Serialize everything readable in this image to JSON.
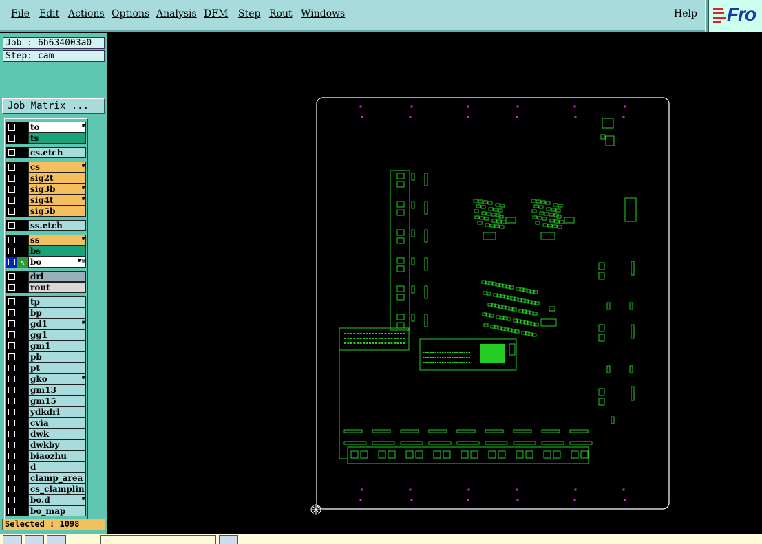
{
  "menu": {
    "items": [
      {
        "label": "File"
      },
      {
        "label": "Edit"
      },
      {
        "label": "Actions"
      },
      {
        "label": "Options"
      },
      {
        "label": "Analysis"
      },
      {
        "label": "DFM"
      },
      {
        "label": "Step"
      },
      {
        "label": "Rout"
      },
      {
        "label": "Windows"
      }
    ],
    "help": "Help"
  },
  "logo": {
    "text": "Fro"
  },
  "job_label": "Job : 6b634003a0",
  "step_label": "Step: cam",
  "job_matrix_button": "Job Matrix ...",
  "layers": [
    {
      "name": "to",
      "color": "#ffffff",
      "marker": "hand"
    },
    {
      "name": "ts",
      "color": "#1aa37a"
    },
    {
      "name": "cs.etch",
      "color": "#a8dcdc"
    },
    {
      "name": "cs",
      "color": "#f5be5e",
      "marker": "hand"
    },
    {
      "name": "sig2t",
      "color": "#f5be5e"
    },
    {
      "name": "sig3b",
      "color": "#f5be5e",
      "marker": "hand"
    },
    {
      "name": "sig4t",
      "color": "#f5be5e",
      "marker": "hand"
    },
    {
      "name": "sig5b",
      "color": "#f5be5e"
    },
    {
      "name": "ss.etch",
      "color": "#a8dcdc"
    },
    {
      "name": "ss",
      "color": "#f5be5e",
      "marker": "hand"
    },
    {
      "name": "bs",
      "color": "#1aa37a"
    },
    {
      "name": "bo",
      "color": "#ffffff",
      "marker": "hand-grid",
      "active": true
    },
    {
      "name": "drl",
      "color": "#9ab0b8"
    },
    {
      "name": "rout",
      "color": "#d8d8d8"
    },
    {
      "name": "tp",
      "color": "#a8dcdc"
    },
    {
      "name": "bp",
      "color": "#a8dcdc"
    },
    {
      "name": "gd1",
      "color": "#a8dcdc",
      "marker": "hand"
    },
    {
      "name": "gg1",
      "color": "#a8dcdc"
    },
    {
      "name": "gm1",
      "color": "#a8dcdc"
    },
    {
      "name": "pb",
      "color": "#a8dcdc"
    },
    {
      "name": "pt",
      "color": "#a8dcdc"
    },
    {
      "name": "gko",
      "color": "#a8dcdc",
      "marker": "hand"
    },
    {
      "name": "gm13",
      "color": "#a8dcdc"
    },
    {
      "name": "gm15",
      "color": "#a8dcdc"
    },
    {
      "name": "ydkdrl",
      "color": "#a8dcdc"
    },
    {
      "name": "cvia",
      "color": "#a8dcdc"
    },
    {
      "name": "dwk",
      "color": "#a8dcdc"
    },
    {
      "name": "dwkby",
      "color": "#a8dcdc"
    },
    {
      "name": "biaozhu",
      "color": "#a8dcdc"
    },
    {
      "name": "d",
      "color": "#a8dcdc"
    },
    {
      "name": "clamp_area",
      "color": "#a8dcdc"
    },
    {
      "name": "cs_clampline",
      "color": "#a8dcdc"
    },
    {
      "name": "bo.d",
      "color": "#a8dcdc",
      "marker": "hand"
    },
    {
      "name": "bo_map",
      "color": "#a8dcdc"
    }
  ],
  "selected_label": "Selected : 1098",
  "colors": {
    "graphics": "#22cc22",
    "board_outline": "#ffffff",
    "fiducial": "#dd22dd"
  }
}
